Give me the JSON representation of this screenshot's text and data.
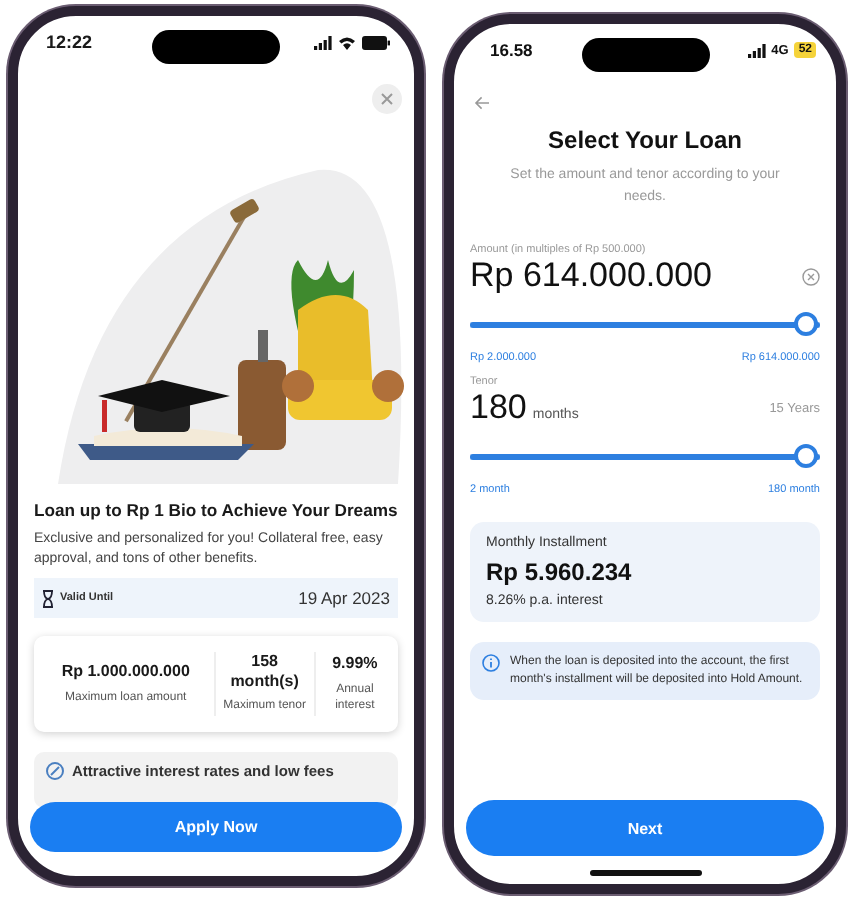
{
  "offer_screen": {
    "status_bar": {
      "time": "12:22"
    },
    "title": "Loan up to Rp 1 Bio to Achieve Your Dreams",
    "description": "Exclusive and personalized for you! Collateral free, easy approval, and tons of other benefits.",
    "valid": {
      "label": "Valid Until",
      "date": "19 Apr 2023"
    },
    "stats": [
      {
        "value": "Rp 1.000.000.000",
        "label": "Maximum loan amount"
      },
      {
        "value": "158 month(s)",
        "label": "Maximum tenor"
      },
      {
        "value": "9.99%",
        "label": "Annual interest"
      }
    ],
    "features": [
      "Attractive interest rates and low fees"
    ],
    "button": "Apply Now"
  },
  "select_screen": {
    "status_bar": {
      "time": "16.58",
      "network": "4G",
      "battery": "52"
    },
    "title": "Select Your Loan",
    "subtitle": "Set the amount and tenor according to your needs.",
    "amount": {
      "label": "Amount (in multiples of Rp 500.000)",
      "value": "Rp 614.000.000",
      "level": 1,
      "min": "Rp 2.000.000",
      "max": "Rp 614.000.000"
    },
    "tenor": {
      "label": "Tenor",
      "value": "180",
      "unit": "months",
      "years": "15 Years",
      "level": 1,
      "min": "2 month",
      "max": "180 month"
    },
    "installment": {
      "label": "Monthly Installment",
      "value": "Rp 5.960.234",
      "interest": "8.26% p.a. interest"
    },
    "notice": "When the loan is deposited into the account, the first month's installment will be deposited into Hold Amount.",
    "button": "Next"
  }
}
